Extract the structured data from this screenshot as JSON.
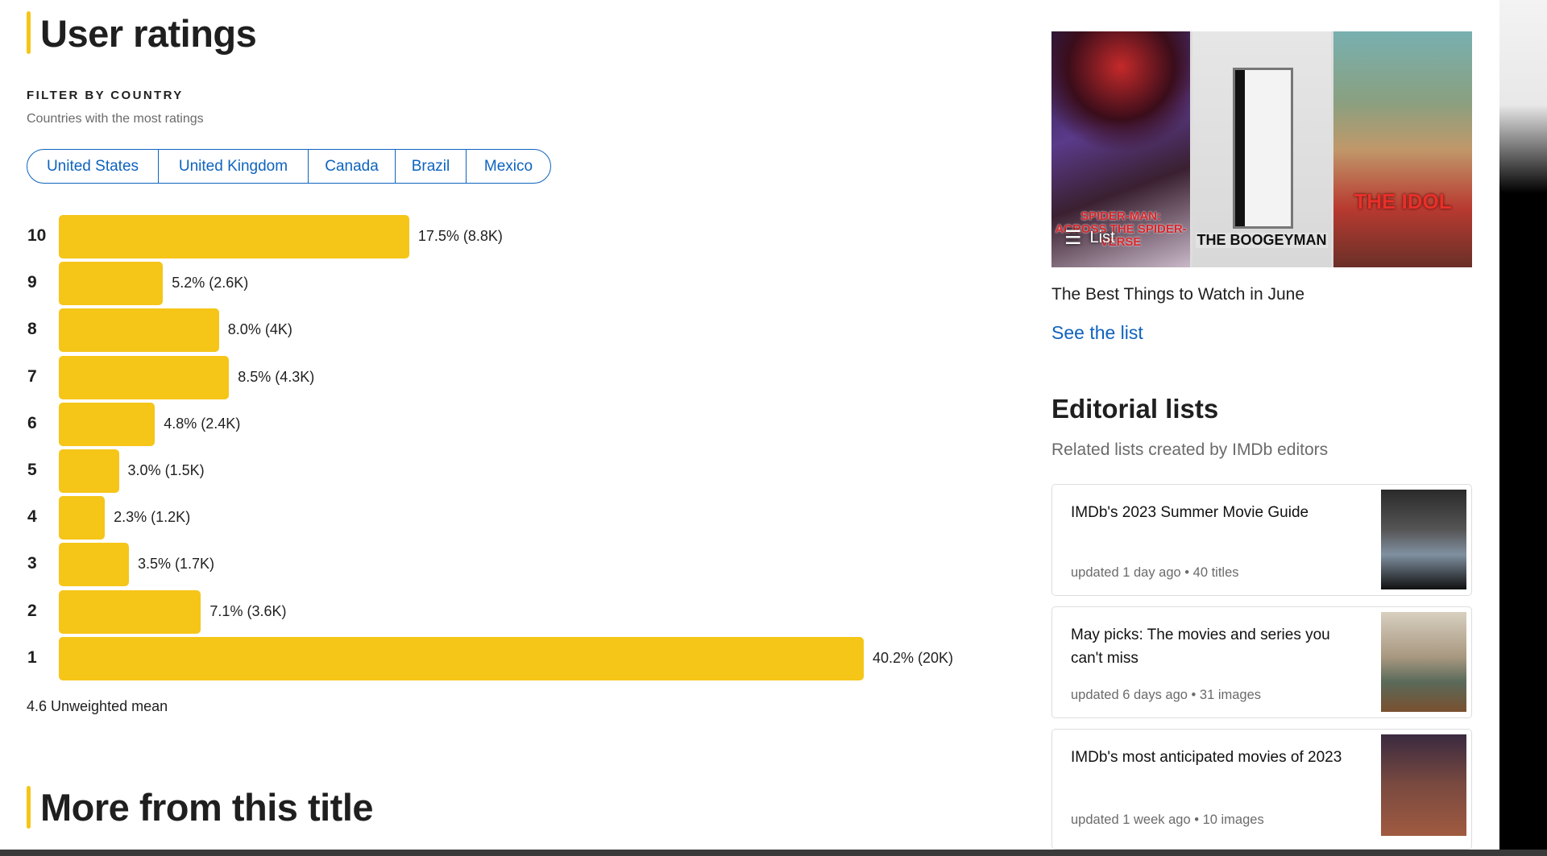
{
  "ratings": {
    "title": "User ratings",
    "filter_label": "FILTER BY COUNTRY",
    "filter_sub": "Countries with the most ratings",
    "countries": [
      "United States",
      "United Kingdom",
      "Canada",
      "Brazil",
      "Mexico"
    ],
    "mean": "4.6 Unweighted mean"
  },
  "chart_data": {
    "type": "bar",
    "orientation": "horizontal",
    "categories": [
      "10",
      "9",
      "8",
      "7",
      "6",
      "5",
      "4",
      "3",
      "2",
      "1"
    ],
    "values": [
      17.5,
      5.2,
      8.0,
      8.5,
      4.8,
      3.0,
      2.3,
      3.5,
      7.1,
      40.2
    ],
    "labels": [
      "17.5% (8.8K)",
      "5.2% (2.6K)",
      "8.0% (4K)",
      "8.5% (4.3K)",
      "4.8% (2.4K)",
      "3.0% (1.5K)",
      "2.3% (1.2K)",
      "3.5% (1.7K)",
      "7.1% (3.6K)",
      "40.2% (20K)"
    ],
    "unit": "%",
    "color": "#f5c518",
    "grid": false
  },
  "more": {
    "title": "More from this title"
  },
  "featured": {
    "badge": "List",
    "badge_icon": "list-icon",
    "title": "The Best Things to Watch in June",
    "link": "See the list",
    "posters": [
      "Spider-Man: Across the Spider-Verse",
      "The Boogeyman",
      "The Idol"
    ]
  },
  "editorial": {
    "title": "Editorial lists",
    "subtitle": "Related lists created by IMDb editors",
    "cards": [
      {
        "title": "IMDb's 2023 Summer Movie Guide",
        "meta": "updated 1 day ago • 40 titles"
      },
      {
        "title": "May picks: The movies and series you can't miss",
        "meta": "updated 6 days ago • 31 images"
      },
      {
        "title": "IMDb's most anticipated movies of 2023",
        "meta": "updated 1 week ago • 10 images"
      }
    ]
  },
  "colors": {
    "accent": "#f5c518",
    "link": "#0e63be"
  }
}
